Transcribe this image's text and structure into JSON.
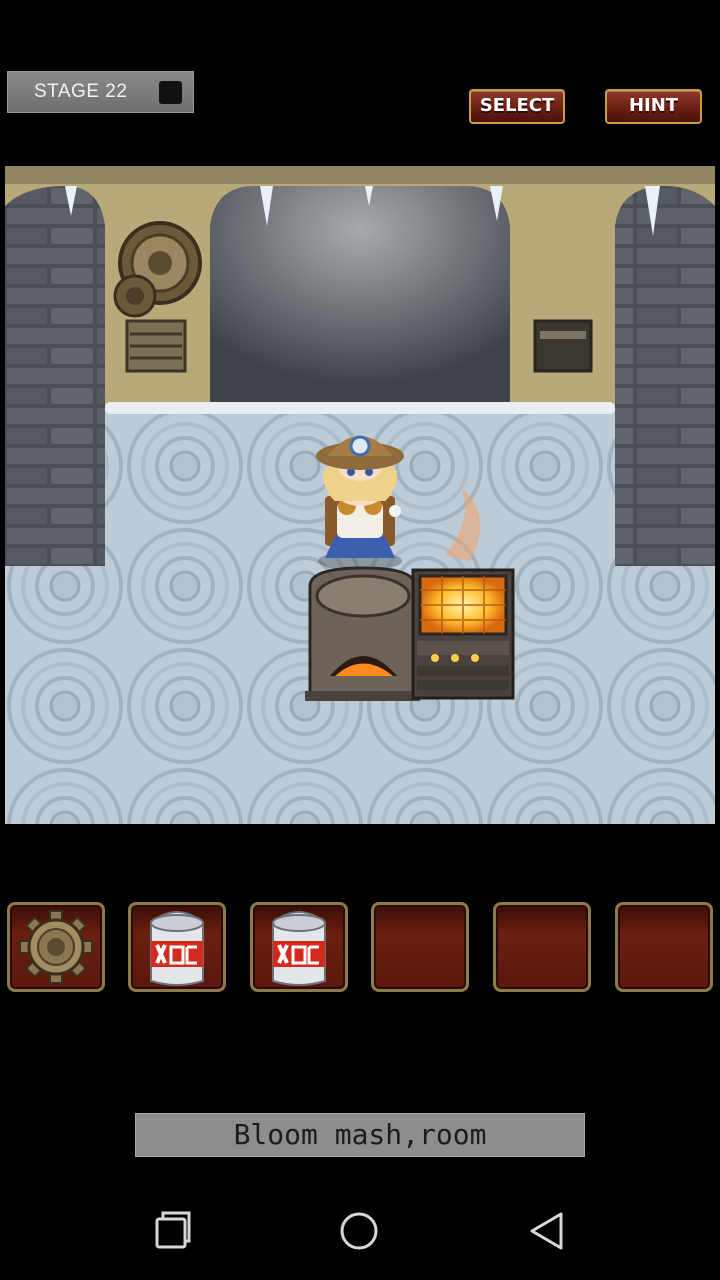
{
  "header": {
    "stage_label": "STAGE 22",
    "select_label": "SELECT",
    "hint_label": "HINT"
  },
  "scene": {
    "icons": [
      "gear-wall-device-icon",
      "wall-vent-left-icon",
      "wall-vent-right-icon",
      "explorer-girl-character",
      "stone-stove-icon",
      "glowing-furnace-icon"
    ]
  },
  "inventory": {
    "slots": [
      {
        "item": "gear-icon"
      },
      {
        "item": "gas-can-icon"
      },
      {
        "item": "gas-can-icon"
      },
      {
        "item": ""
      },
      {
        "item": ""
      },
      {
        "item": ""
      }
    ]
  },
  "caption": {
    "text": "Bloom mash,room"
  },
  "navbar": {
    "icons": [
      "recent-apps-icon",
      "home-icon",
      "back-icon"
    ]
  },
  "colors": {
    "button_red": "#6a1f15",
    "button_border": "#c89b45",
    "slot_border": "#8c7a48",
    "caption_bg": "#8d8d8d"
  }
}
